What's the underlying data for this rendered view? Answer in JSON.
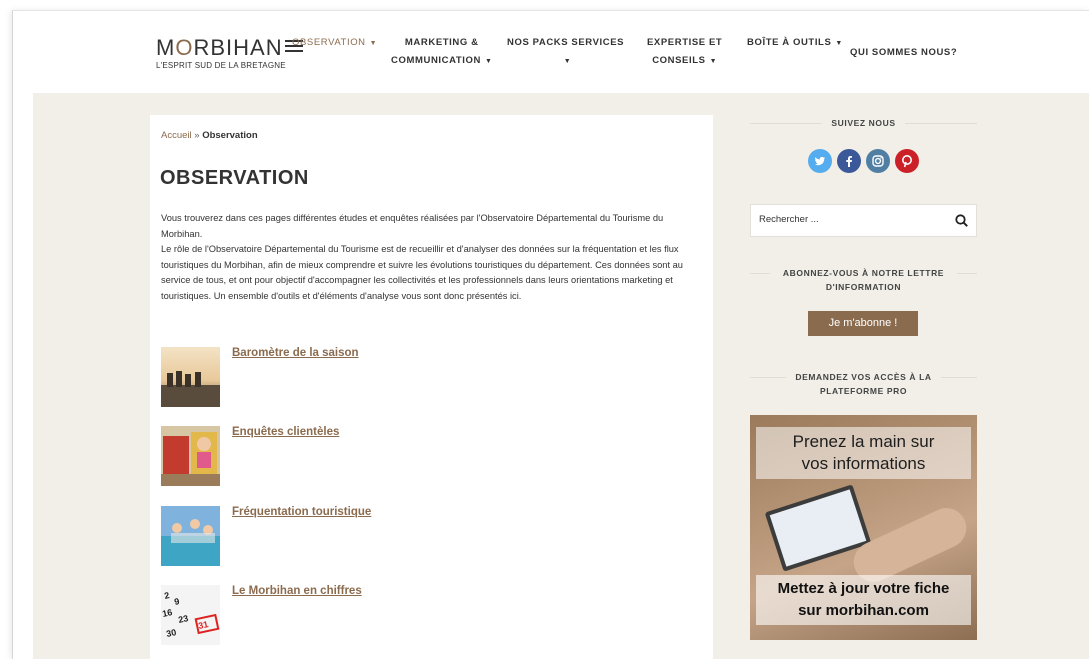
{
  "header": {
    "logo": {
      "title_pre": "M",
      "title_o": "O",
      "title_post": "RBIHAN",
      "tagline": "L'ESPRIT SUD DE LA BRETAGNE"
    },
    "nav": [
      {
        "label": "OBSERVATION"
      },
      {
        "label_line1": "MARKETING &",
        "label_line2": "COMMUNICATION"
      },
      {
        "label_line1": "NOS PACKS SERVICES"
      },
      {
        "label_line1": "EXPERTISE ET",
        "label_line2": "CONSEILS"
      },
      {
        "label": "BOÎTE À OUTILS"
      },
      {
        "label": "QUI SOMMES NOUS?"
      }
    ]
  },
  "breadcrumb": {
    "home": "Accueil",
    "separator": " » ",
    "current": "Observation"
  },
  "page": {
    "title": "OBSERVATION",
    "intro_p1": "Vous trouverez dans ces pages différentes études et enquêtes réalisées par l'Observatoire Départemental du Tourisme du Morbihan.",
    "intro_p2": "Le rôle de l'Observatoire Départemental du Tourisme est de recueillir et d'analyser des données sur la fréquentation et les flux touristiques du Morbihan, afin de mieux comprendre et suivre les évolutions touristiques du département. Ces données sont au service de tous, et ont pour objectif d'accompagner les collectivités et les professionnels dans leurs orientations marketing et touristiques. Un ensemble d'outils et d'éléments d'analyse vous sont donc présentés ici."
  },
  "items": [
    {
      "label": "Baromètre de la saison"
    },
    {
      "label": "Enquêtes clientèles"
    },
    {
      "label": "Fréquentation touristique"
    },
    {
      "label": "Le Morbihan en chiffres"
    }
  ],
  "sidebar": {
    "follow_title": "SUIVEZ NOUS",
    "social": [
      "t",
      "f",
      "in",
      "p"
    ],
    "search_placeholder": "Rechercher ...",
    "newsletter_title_1": "ABONNEZ-VOUS À NOTRE LETTRE",
    "newsletter_title_2": "D'INFORMATION",
    "subscribe_label": "Je m'abonne !",
    "pro_title_1": "DEMANDEZ VOS ACCÈS À LA",
    "pro_title_2": "PLATEFORME PRO",
    "promo_top_1": "Prenez la main sur",
    "promo_top_2": "vos informations",
    "promo_bottom_1": "Mettez à jour votre fiche",
    "promo_bottom_2": "sur morbihan.com"
  },
  "colors": {
    "accent": "#8b6b4e",
    "twitter": "#55acee",
    "facebook": "#3b5998",
    "instagram": "#517fa4",
    "pinterest": "#cb2027"
  }
}
